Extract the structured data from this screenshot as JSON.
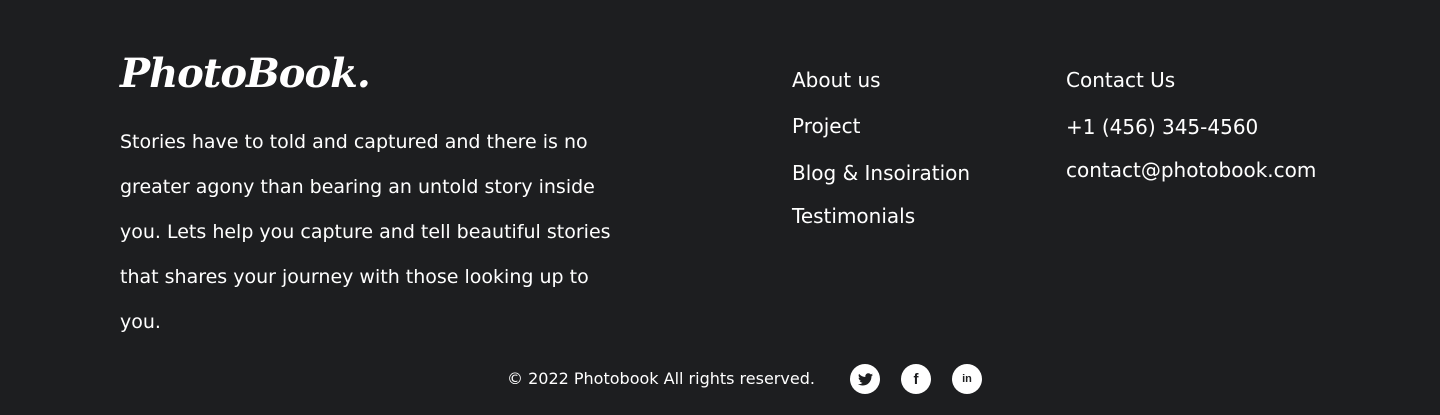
{
  "brand": {
    "logo_text": "PhotoBook."
  },
  "about": {
    "text": "Stories have to told and captured and there is no greater agony than bearing an untold story inside you. Lets help you capture and tell beautiful stories that shares your journey with those looking up to you."
  },
  "nav": {
    "items": [
      {
        "label": "About us"
      },
      {
        "label": "Project"
      },
      {
        "label": "Blog & Insoiration"
      },
      {
        "label": "Testimonials"
      }
    ]
  },
  "contact": {
    "heading": "Contact Us",
    "phone": "+1 (456) 345-4560",
    "email": "contact@photobook.com"
  },
  "footer": {
    "copyright": "© 2022 Photobook All rights reserved.",
    "social": [
      {
        "icon": "twitter-icon"
      },
      {
        "icon": "facebook-icon"
      },
      {
        "icon": "linkedin-icon"
      }
    ]
  },
  "colors": {
    "background": "#1d1e20",
    "text": "#ffffff"
  }
}
